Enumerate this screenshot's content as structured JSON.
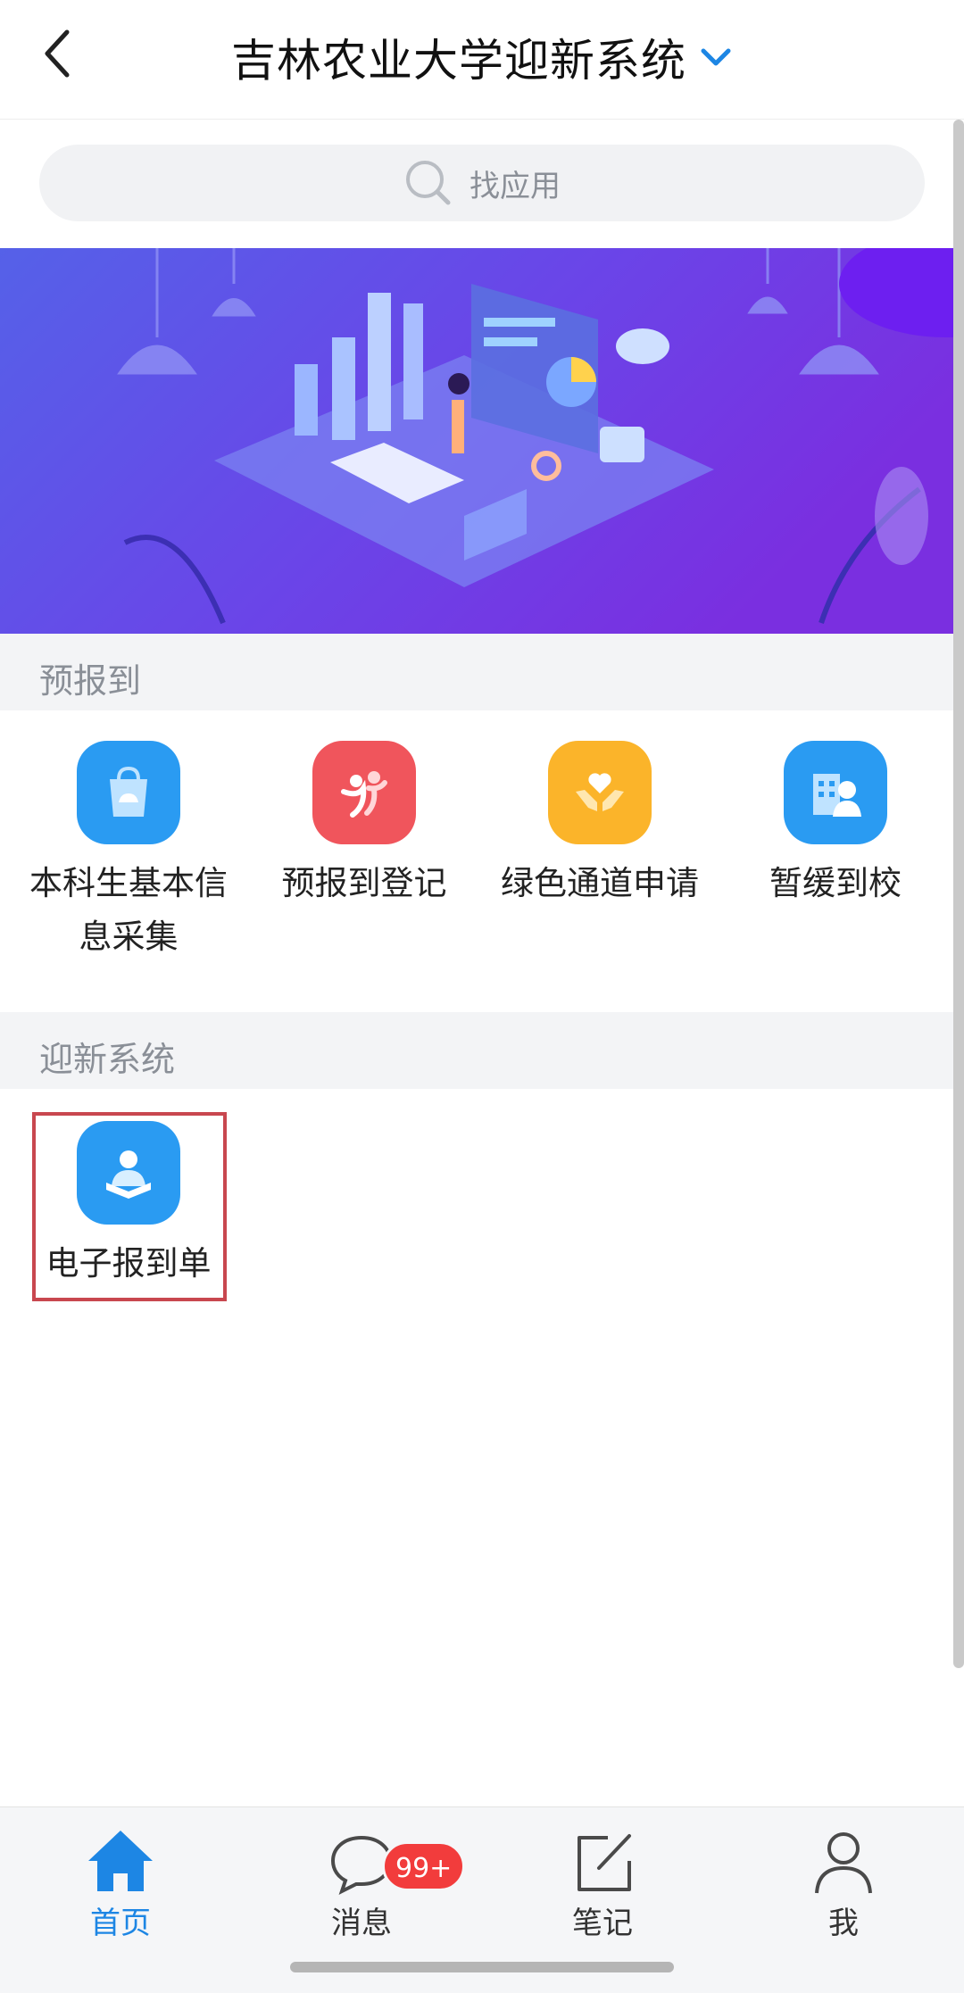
{
  "header": {
    "title": "吉林农业大学迎新系统",
    "back_icon": "chevron-left-icon",
    "dropdown_icon": "chevron-down-icon",
    "accent_color": "#1d86e4"
  },
  "search": {
    "placeholder": "找应用",
    "icon": "search-icon"
  },
  "sections": [
    {
      "title": "预报到",
      "apps": [
        {
          "label": "本科生基本信息采集",
          "icon": "bag-icon",
          "color": "#2a9bf2"
        },
        {
          "label": "预报到登记",
          "icon": "people-icon",
          "color": "#f0555c"
        },
        {
          "label": "绿色通道申请",
          "icon": "heart-hands-icon",
          "color": "#fbb42a"
        },
        {
          "label": "暂缓到校",
          "icon": "person-building-icon",
          "color": "#2a9bf2"
        }
      ]
    },
    {
      "title": "迎新系统",
      "apps": [
        {
          "label": "电子报到单",
          "icon": "student-reading-icon",
          "color": "#2a9bf2"
        }
      ]
    }
  ],
  "bottom_nav": {
    "items": [
      {
        "label": "首页",
        "icon": "home-icon",
        "active": true
      },
      {
        "label": "消息",
        "icon": "chat-icon",
        "badge": "99+"
      },
      {
        "label": "笔记",
        "icon": "edit-note-icon"
      },
      {
        "label": "我",
        "icon": "user-icon"
      }
    ]
  }
}
